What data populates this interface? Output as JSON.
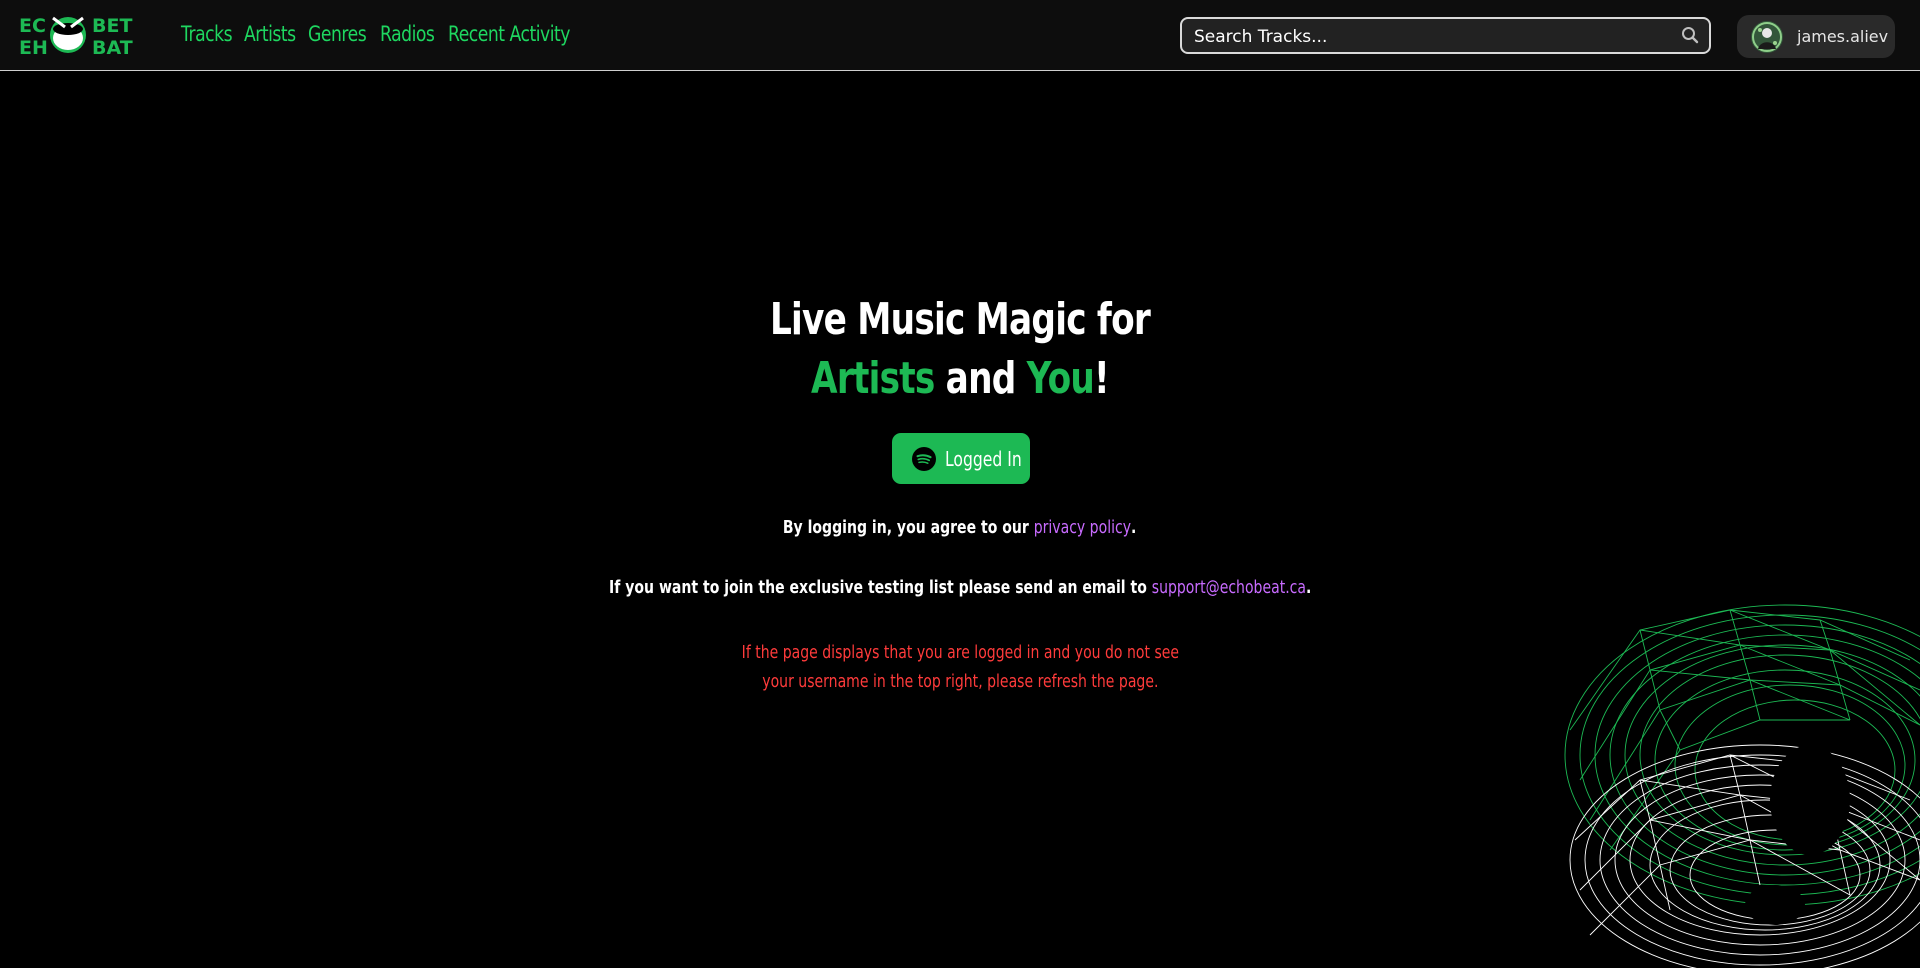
{
  "brand": {
    "logo_text_left_top": "EC",
    "logo_text_left_bottom": "EH",
    "logo_text_right_top": "BET",
    "logo_text_right_bottom": "BAT",
    "accent_color": "#1db954"
  },
  "nav": {
    "items": [
      {
        "label": "Tracks"
      },
      {
        "label": "Artists"
      },
      {
        "label": "Genres"
      },
      {
        "label": "Radios"
      },
      {
        "label": "Recent Activity"
      }
    ]
  },
  "search": {
    "placeholder": "Search Tracks...",
    "icon": "search-icon"
  },
  "user": {
    "username": "james.aliev"
  },
  "hero": {
    "line1": "Live Music Magic for",
    "word_artists": "Artists",
    "word_and": " and ",
    "word_you": "You",
    "exclaim": "!"
  },
  "login_button": {
    "label": "Logged In",
    "icon": "spotify-icon"
  },
  "policy": {
    "prefix": "By logging in, you agree to our ",
    "link_text": "privacy policy",
    "suffix": "."
  },
  "testing": {
    "prefix": "If you want to join the exclusive testing list please send an email to ",
    "email": "support@echobeat.ca",
    "suffix": "."
  },
  "warning": {
    "line1": "If the page displays that you are logged in and you do not see",
    "line2": "your username in the top right, please refresh the page.",
    "color": "#ff3b3b"
  }
}
